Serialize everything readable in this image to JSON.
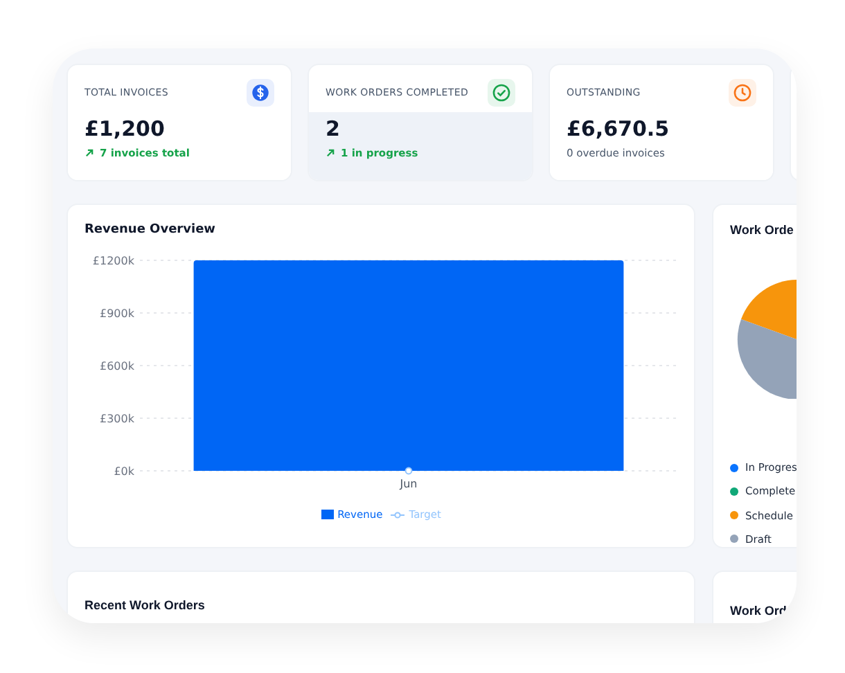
{
  "stats": [
    {
      "label": "TOTAL INVOICES",
      "value": "£1,200",
      "note": "7 invoices total",
      "trend": true,
      "kind": "dollar",
      "highlighted": false
    },
    {
      "label": "WORK ORDERS COMPLETED",
      "value": "2",
      "note": "1 in progress",
      "trend": true,
      "kind": "check",
      "highlighted": true
    },
    {
      "label": "OUTSTANDING",
      "value": "£6,670.5",
      "note": "0 overdue invoices",
      "trend": false,
      "kind": "clock",
      "highlighted": false
    }
  ],
  "revenue": {
    "title": "Revenue Overview",
    "chart_data": {
      "type": "bar",
      "grid": true,
      "categories": [
        "Jun"
      ],
      "ylim": [
        0,
        1200
      ],
      "yticks": [
        {
          "value": 0,
          "label": "£0k"
        },
        {
          "value": 300,
          "label": "£300k"
        },
        {
          "value": 600,
          "label": "£600k"
        },
        {
          "value": 900,
          "label": "£900k"
        },
        {
          "value": 1200,
          "label": "£1200k"
        }
      ],
      "series": [
        {
          "name": "Revenue",
          "color": "#0066f5",
          "values": [
            1200
          ]
        },
        {
          "name": "Target",
          "color": "#93c5fd",
          "values": [
            0
          ]
        }
      ]
    }
  },
  "status_card": {
    "title": "Work Orde",
    "legend": [
      {
        "label": "In Progres",
        "color": "#0a74ff"
      },
      {
        "label": "Complete",
        "color": "#10a878"
      },
      {
        "label": "Schedule",
        "color": "#f7950c"
      },
      {
        "label": "Draft",
        "color": "#94a3b8"
      }
    ]
  },
  "bottom": [
    {
      "title": "Recent Work Orders"
    },
    {
      "title": "Work Ord"
    }
  ]
}
